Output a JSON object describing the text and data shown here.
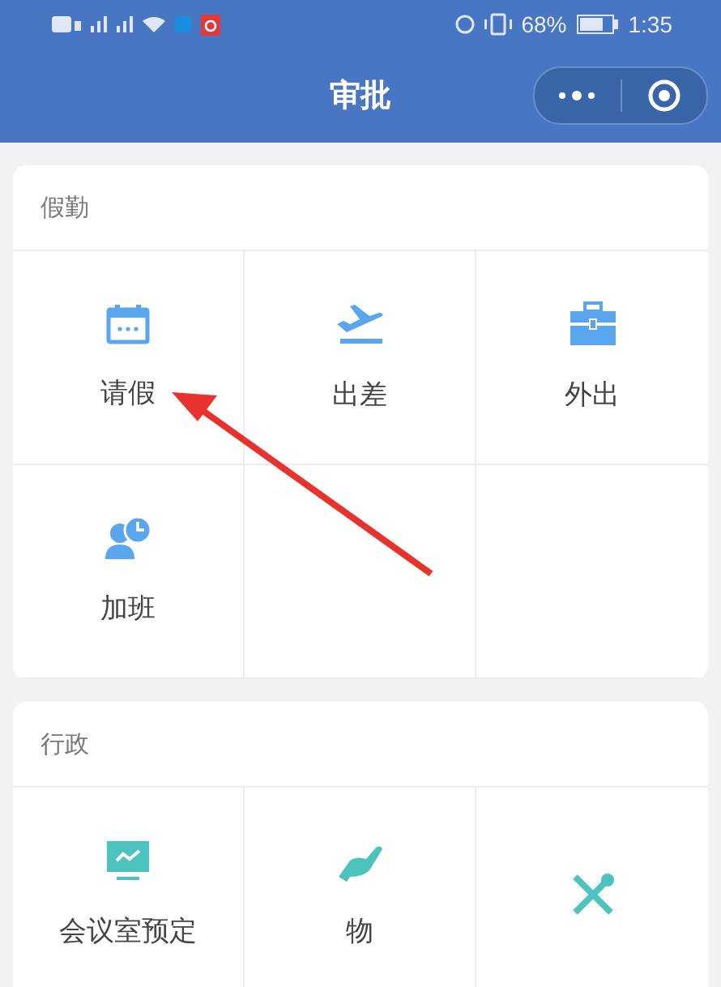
{
  "status_bar": {
    "battery": "68%",
    "time": "1:35"
  },
  "header": {
    "title": "审批"
  },
  "sections": [
    {
      "title": "假勤",
      "items": [
        {
          "label": "请假",
          "kind": "calendar"
        },
        {
          "label": "出差",
          "kind": "plane"
        },
        {
          "label": "外出",
          "kind": "briefcase"
        },
        {
          "label": "加班",
          "kind": "overtime"
        },
        {
          "kind": "empty"
        },
        {
          "kind": "empty"
        }
      ]
    },
    {
      "title": "行政",
      "items": [
        {
          "label": "会议室预定",
          "kind": "meeting"
        },
        {
          "label": "物",
          "kind": "supplies"
        },
        {
          "kind": "tools"
        }
      ]
    }
  ]
}
